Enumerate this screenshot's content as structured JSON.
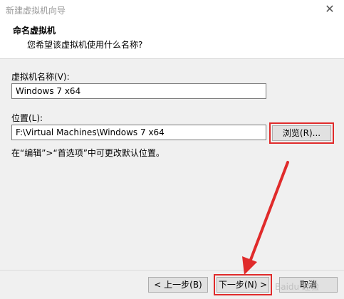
{
  "window": {
    "title": "新建虚拟机向导"
  },
  "header": {
    "title": "命名虚拟机",
    "subtitle": "您希望该虚拟机使用什么名称?"
  },
  "vm_name": {
    "label": "虚拟机名称(V):",
    "value": "Windows 7 x64"
  },
  "location": {
    "label": "位置(L):",
    "value": "F:\\Virtual Machines\\Windows 7 x64",
    "browse_label": "浏览(R)...",
    "hint": "在“编辑”>“首选项”中可更改默认位置。"
  },
  "buttons": {
    "back": "< 上一步(B)",
    "next": "下一步(N) >",
    "cancel": "取消"
  },
  "watermark": "Baidu 经验",
  "colors": {
    "highlight": "#e02b2b",
    "panel": "#f0f0f0"
  }
}
